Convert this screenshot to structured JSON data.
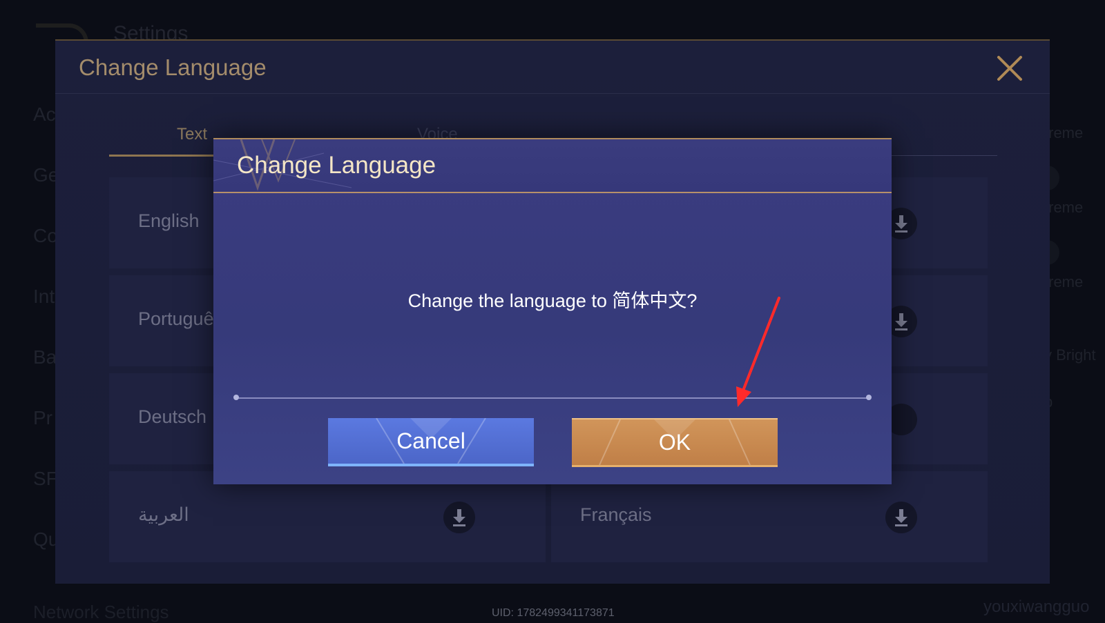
{
  "background": {
    "settings_title": "Settings",
    "side_items": [
      "Ac",
      "Ge",
      "Co",
      "Int",
      "Ba",
      "Pr",
      "SF",
      "Qu"
    ],
    "right_items": [
      "treme",
      "treme",
      "treme",
      "y Bright",
      "p"
    ],
    "network_settings": "Network Settings",
    "uid": "UID: 1782499341173871",
    "watermark": "youxiwangguo"
  },
  "panel": {
    "title": "Change Language",
    "tabs": [
      {
        "label": "Text",
        "active": true
      },
      {
        "label": "Voice",
        "active": false
      }
    ],
    "languages": [
      {
        "label": "English",
        "download": true
      },
      {
        "label": "Portuguê",
        "download": true
      },
      {
        "label": "Deutsch",
        "download": false
      },
      {
        "label": "العربية",
        "download": true
      },
      {
        "label": "Français",
        "download": true
      }
    ]
  },
  "dialog": {
    "title": "Change Language",
    "message": "Change the language to 简体中文?",
    "cancel_label": "Cancel",
    "ok_label": "OK"
  },
  "colors": {
    "accent_gold": "#a48c6b",
    "dialog_bg": "#38397c",
    "cancel_blue": "#5470d6",
    "ok_orange": "#c98a50",
    "annotation_red": "#ff2a2a"
  },
  "icons": {
    "close": "close-icon",
    "download": "download-icon",
    "back": "back-arrow-icon",
    "annotation": "red-arrow-annotation"
  }
}
